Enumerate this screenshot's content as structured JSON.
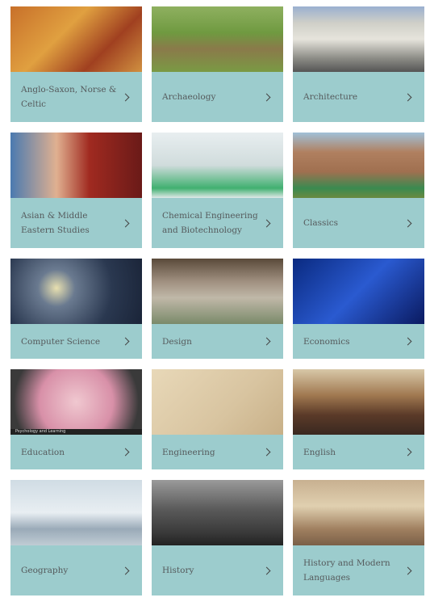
{
  "subjects": [
    {
      "label": "Anglo-Saxon, Norse & Celtic",
      "image": "illuminated-manuscript",
      "bg": "linear-gradient(135deg,#c8702a,#e0a040 40%,#a04020 70%,#d09040)"
    },
    {
      "label": "Archaeology",
      "image": "excavation-site",
      "bg": "linear-gradient(180deg,#8fb060 0%,#6f9a40 40%,#8a7a4a 65%,#7a9a44 100%)"
    },
    {
      "label": "Architecture",
      "image": "classical-building",
      "bg": "linear-gradient(180deg,#9ab0d0 0%,#cfcfc8 25%,#e6e4dc 50%,#8a8a84 80%,#555 100%)"
    },
    {
      "label": "Asian & Middle Eastern Studies",
      "image": "pagoda",
      "bg": "linear-gradient(90deg,#4a7ab0 0%,#e0b090 35%,#a02a20 60%,#6a1a18 100%)"
    },
    {
      "label": "Chemical Engineering and Biotechnology",
      "image": "lab-scientist",
      "bg": "linear-gradient(180deg,#e8eef0 0%,#d0dcdc 50%,#40b070 85%,#e0e8e8 100%)"
    },
    {
      "label": "Classics",
      "image": "roman-ruins",
      "bg": "linear-gradient(180deg,#a0c0d8 0%,#b08060 30%,#a07050 60%,#3a8a50 85%,#6a8a40 100%)"
    },
    {
      "label": "Computer Science",
      "image": "circuit-board",
      "bg": "radial-gradient(circle at 35% 45%,#e8e0b0 0%,#6a7a90 20%,#2a3850 60%,#1a2438 100%)"
    },
    {
      "label": "Design",
      "image": "design-studio",
      "bg": "linear-gradient(180deg,#5a4a3a 0%,#a09080 35%,#c0b8a8 60%,#7a8a6a 100%)"
    },
    {
      "label": "Economics",
      "image": "stock-data",
      "bg": "linear-gradient(135deg,#0a2a80 0%,#2a5ad0 50%,#0a1a60 100%)"
    },
    {
      "label": "Education",
      "image": "psychology-learning",
      "caption": "Psychology and Learning",
      "bg": "radial-gradient(circle at 50% 50%,#f0c8d0 0%,#d890a8 50%,#3a3a3a 85%)"
    },
    {
      "label": "Engineering",
      "image": "technical-sketch",
      "bg": "linear-gradient(135deg,#e8d8b8 0%,#d8c4a0 60%,#c8b088 100%)"
    },
    {
      "label": "English",
      "image": "library",
      "bg": "linear-gradient(180deg,#d8c8a8 0%,#a07850 40%,#5a3a28 70%,#3a2820 100%)"
    },
    {
      "label": "Geography",
      "image": "polar-explorer",
      "bg": "linear-gradient(180deg,#d0dce4 0%,#e8eef2 50%,#9aaab8 75%,#c0ccd4 100%)"
    },
    {
      "label": "History",
      "image": "historical-crowd",
      "bg": "linear-gradient(180deg,#9a9a9a 0%,#5a5a5a 45%,#3a3a3a 80%,#222 100%)"
    },
    {
      "label": "History and Modern Languages",
      "image": "trevi-fountain",
      "bg": "linear-gradient(180deg,#c8b090 0%,#e0d0b0 40%,#a08060 75%,#7a6048 100%)"
    }
  ],
  "colors": {
    "label_bg": "#9ccccd",
    "label_text": "#555a5c"
  }
}
